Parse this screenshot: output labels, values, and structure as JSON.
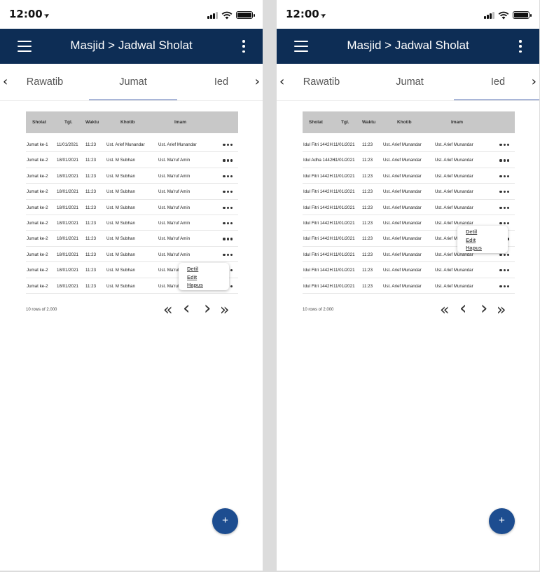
{
  "status_time": "12:00",
  "status_icons": [
    "location-arrow-icon",
    "signal-icon",
    "wifi-icon",
    "battery-icon"
  ],
  "app_title": "Masjid > Jadwal Sholat",
  "colors": {
    "appbar": "#0d2d55",
    "tab_indicator": "#3e5aa8",
    "fab": "#1d4d90",
    "table_header": "#c8c8c8"
  },
  "tabs": [
    "Rawatib",
    "Jumat",
    "Ied"
  ],
  "columns": [
    "Sholat",
    "Tgl.",
    "Waktu",
    "Khotib",
    "Imam"
  ],
  "rows_info": "10 rows of 2.000",
  "popup_menu": [
    "Detil",
    "Edit",
    "Hapus"
  ],
  "fab_label": "+",
  "screens": [
    {
      "active_tab": "Jumat",
      "popup_row": 8,
      "rows": [
        [
          "Jumat ke-1",
          "11/01/2021",
          "11:23",
          "Ust. Arief Munandar",
          "Ust. Arief Munandar"
        ],
        [
          "Jumat ke-2",
          "18/01/2021",
          "11:23",
          "Ust. M Subhan",
          "Ust. Ma'ruf Amin"
        ],
        [
          "Jumat ke-2",
          "18/01/2021",
          "11:23",
          "Ust. M Subhan",
          "Ust. Ma'ruf Amin"
        ],
        [
          "Jumat ke-2",
          "18/01/2021",
          "11:23",
          "Ust. M Subhan",
          "Ust. Ma'ruf Amin"
        ],
        [
          "Jumat ke-2",
          "18/01/2021",
          "11:23",
          "Ust. M Subhan",
          "Ust. Ma'ruf Amin"
        ],
        [
          "Jumat ke-2",
          "18/01/2021",
          "11:23",
          "Ust. M Subhan",
          "Ust. Ma'ruf Amin"
        ],
        [
          "Jumat ke-2",
          "18/01/2021",
          "11:23",
          "Ust. M Subhan",
          "Ust. Ma'ruf Amin"
        ],
        [
          "Jumat ke-2",
          "18/01/2021",
          "11:23",
          "Ust. M Subhan",
          "Ust. Ma'ruf Amin"
        ],
        [
          "Jumat ke-2",
          "18/01/2021",
          "11:23",
          "Ust. M Subhan",
          "Ust. Ma'ruf Amin"
        ],
        [
          "Jumat ke-2",
          "18/01/2021",
          "11:23",
          "Ust. M Subhan",
          "Ust. Ma'ruf Amin"
        ]
      ]
    },
    {
      "active_tab": "Ied",
      "popup_row": 5,
      "rows": [
        [
          "Idul Fitri 1442H",
          "11/01/2021",
          "11:23",
          "Ust. Arief Munandar",
          "Ust. Arief Munandar"
        ],
        [
          "Idul Adha 1442H",
          "11/01/2021",
          "11:23",
          "Ust. Arief Munandar",
          "Ust. Arief Munandar"
        ],
        [
          "Idul Fitri 1442H",
          "11/01/2021",
          "11:23",
          "Ust. Arief Munandar",
          "Ust. Arief Munandar"
        ],
        [
          "Idul Fitri 1442H",
          "11/01/2021",
          "11:23",
          "Ust. Arief Munandar",
          "Ust. Arief Munandar"
        ],
        [
          "Idul Fitri 1442H",
          "11/01/2021",
          "11:23",
          "Ust. Arief Munandar",
          "Ust. Arief Munandar"
        ],
        [
          "Idul Fitri 1442H",
          "11/01/2021",
          "11:23",
          "Ust. Arief Munandar",
          "Ust. Arief Munandar"
        ],
        [
          "Idul Fitri 1442H",
          "11/01/2021",
          "11:23",
          "Ust. Arief Munandar",
          "Ust. Arief Munandar"
        ],
        [
          "Idul Fitri 1442H",
          "11/01/2021",
          "11:23",
          "Ust. Arief Munandar",
          "Ust. Arief Munandar"
        ],
        [
          "Idul Fitri 1442H",
          "11/01/2021",
          "11:23",
          "Ust. Arief Munandar",
          "Ust. Arief Munandar"
        ],
        [
          "Idul Fitri 1442H",
          "11/01/2021",
          "11:23",
          "Ust. Arief Munandar",
          "Ust. Arief Munandar"
        ]
      ]
    }
  ]
}
